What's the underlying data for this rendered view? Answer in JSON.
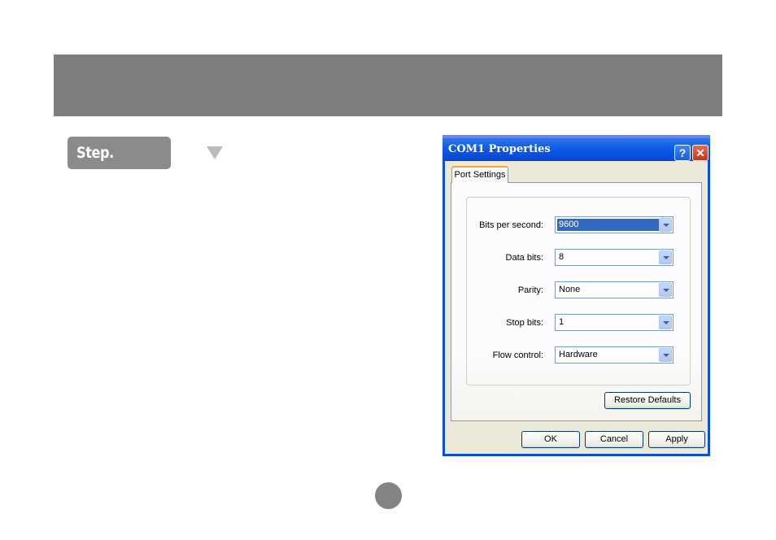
{
  "step": {
    "label": "Step.",
    "arrow_icon": "triangle-down-icon"
  },
  "dialog": {
    "title": "COM1 Properties",
    "help_glyph": "?",
    "close_glyph": "✕",
    "tab": "Port Settings",
    "fields": [
      {
        "label": "Bits per second:",
        "value": "9600",
        "selected": true
      },
      {
        "label": "Data bits:",
        "value": "8"
      },
      {
        "label": "Parity:",
        "value": "None"
      },
      {
        "label": "Stop bits:",
        "value": "1"
      },
      {
        "label": "Flow control:",
        "value": "Hardware"
      }
    ],
    "restore_defaults": "Restore Defaults",
    "ok": "OK",
    "cancel": "Cancel",
    "apply": "Apply"
  },
  "colors": {
    "header_bar": "#7d7e7e",
    "titlebar": "#0a58e4",
    "selection": "#316ac5",
    "dialog_face": "#ece9d8"
  }
}
